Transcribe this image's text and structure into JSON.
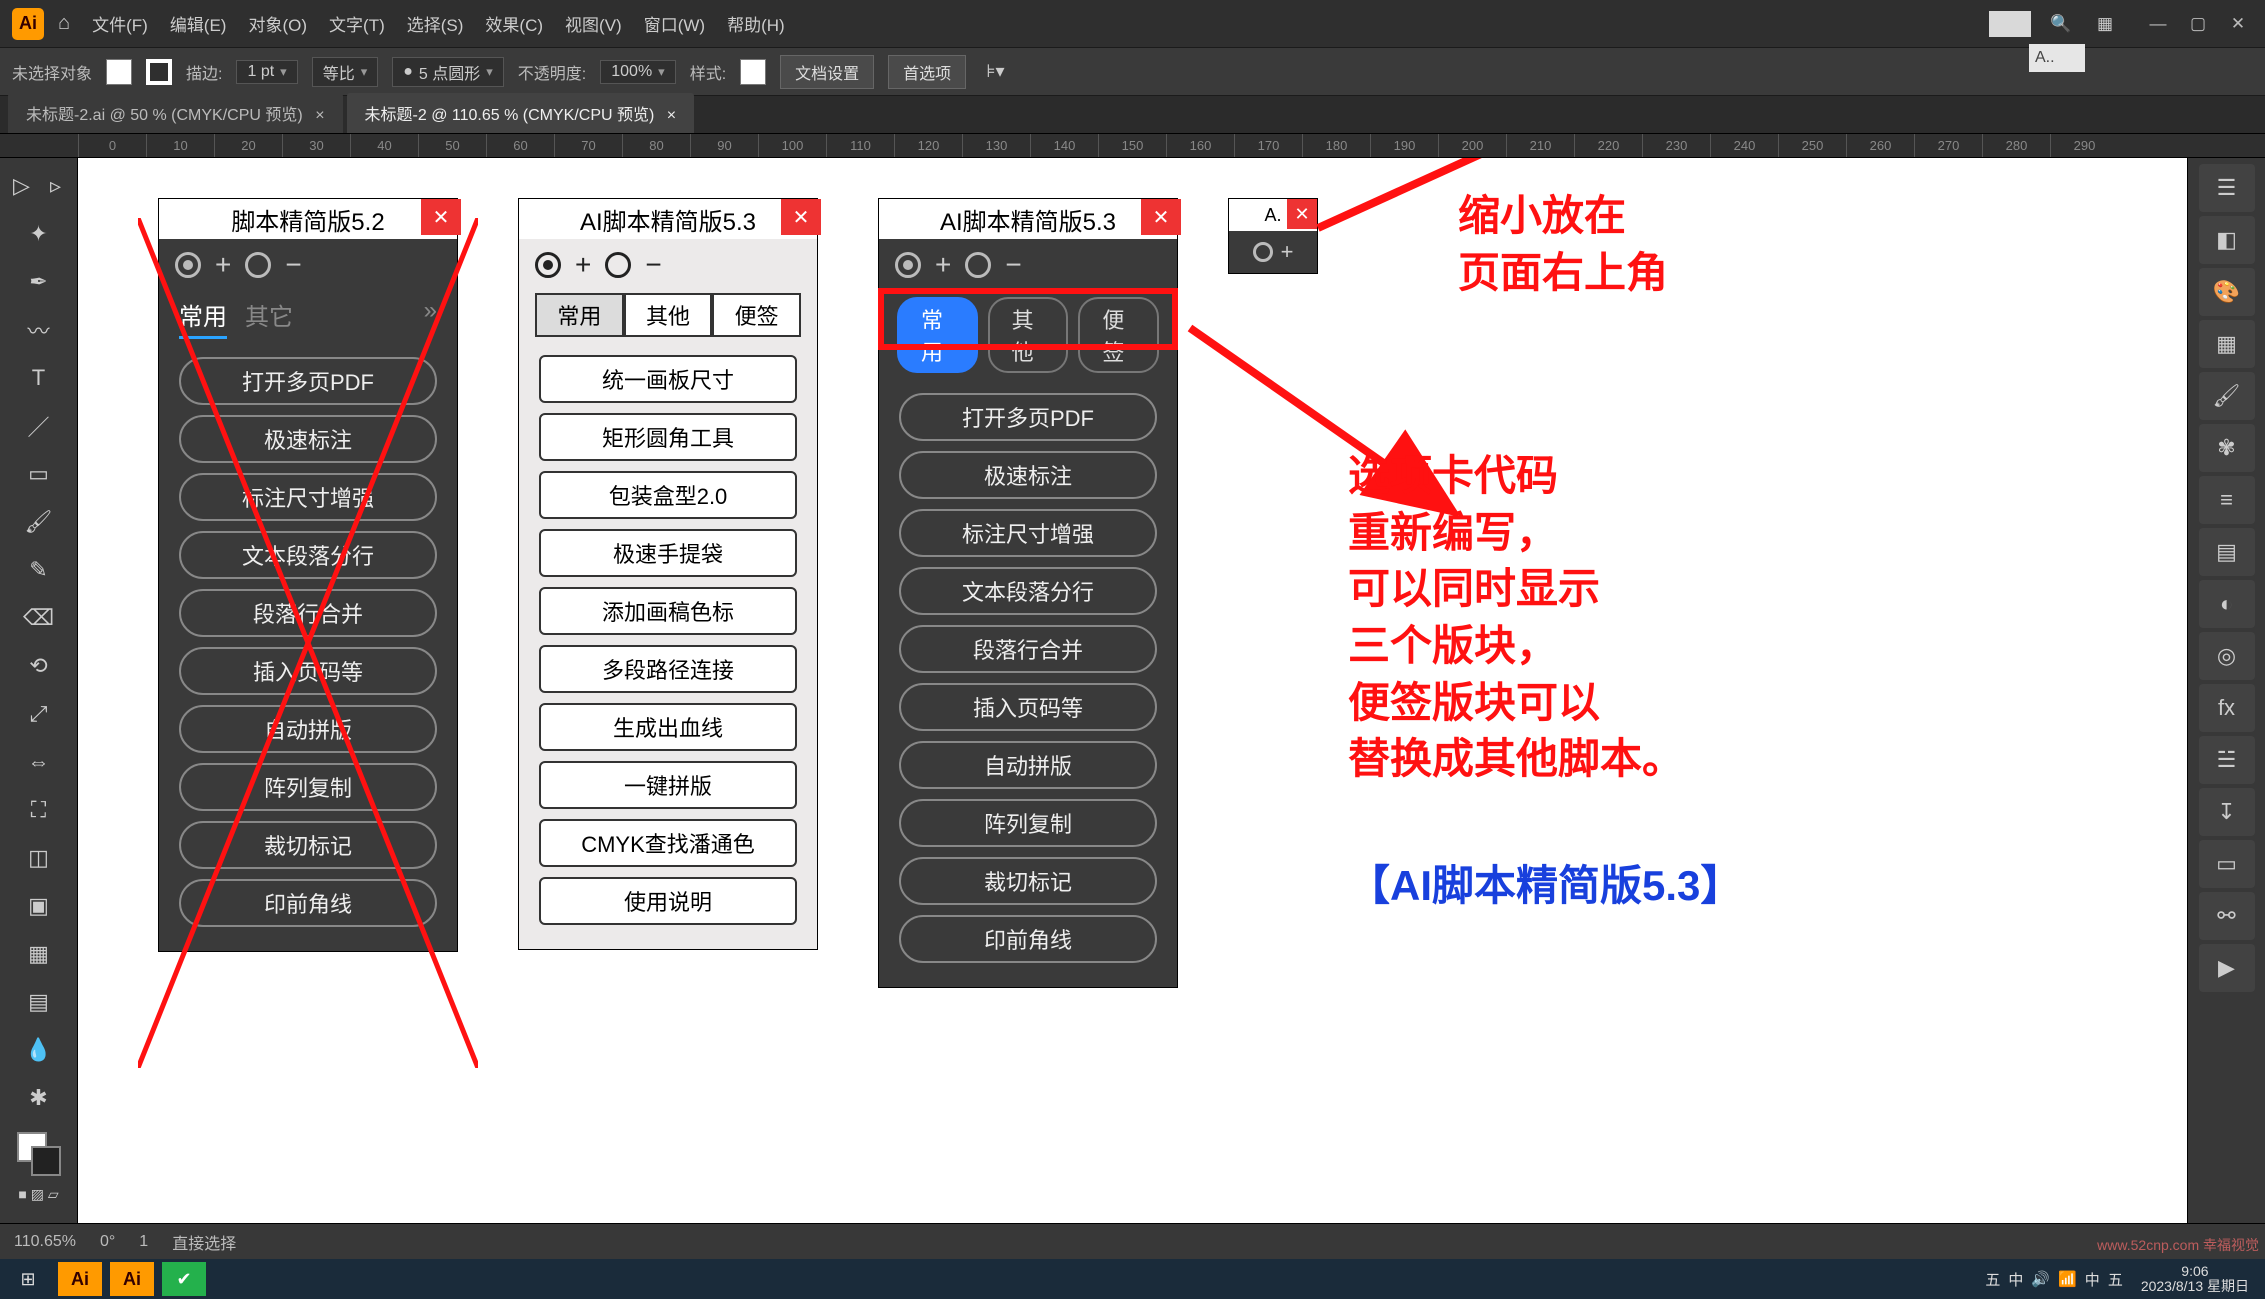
{
  "menubar": {
    "home_icon": "⌂",
    "items": [
      "文件(F)",
      "编辑(E)",
      "对象(O)",
      "文字(T)",
      "选择(S)",
      "效果(C)",
      "视图(V)",
      "窗口(W)",
      "帮助(H)"
    ],
    "search_placeholder": "A..",
    "win": {
      "min": "—",
      "max": "▢",
      "close": "✕"
    }
  },
  "controlbar": {
    "no_selection": "未选择对象",
    "stroke_label": "描边:",
    "stroke_value": "1 pt",
    "uniform": "等比",
    "corner_value": "5 点圆形",
    "opacity_label": "不透明度:",
    "opacity_value": "100%",
    "style_label": "样式:",
    "doc_settings": "文档设置",
    "prefs": "首选项"
  },
  "tabs": [
    {
      "label": "未标题-2.ai @ 50 % (CMYK/CPU 预览)",
      "active": false
    },
    {
      "label": "未标题-2 @ 110.65 % (CMYK/CPU 预览)",
      "active": true
    }
  ],
  "ruler_ticks": [
    "0",
    "10",
    "20",
    "30",
    "40",
    "50",
    "60",
    "70",
    "80",
    "90",
    "100",
    "110",
    "120",
    "130",
    "140",
    "150",
    "160",
    "170",
    "180",
    "190",
    "200",
    "210",
    "220",
    "230",
    "240",
    "250",
    "260",
    "270",
    "280",
    "290"
  ],
  "panels": {
    "p1": {
      "title": "脚本精简版5.2",
      "tabs": [
        "常用",
        "其它"
      ],
      "buttons": [
        "打开多页PDF",
        "极速标注",
        "标注尺寸增强",
        "文本段落分行",
        "段落行合并",
        "插入页码等",
        "自动拼版",
        "阵列复制",
        "裁切标记",
        "印前角线"
      ]
    },
    "p2": {
      "title": "AI脚本精简版5.3",
      "tabs": [
        "常用",
        "其他",
        "便签"
      ],
      "buttons": [
        "统一画板尺寸",
        "矩形圆角工具",
        "包装盒型2.0",
        "极速手提袋",
        "添加画稿色标",
        "多段路径连接",
        "生成出血线",
        "一键拼版",
        "CMYK查找潘通色",
        "使用说明"
      ]
    },
    "p3": {
      "title": "AI脚本精简版5.3",
      "pills": [
        "常用",
        "其他",
        "便签"
      ],
      "buttons": [
        "打开多页PDF",
        "极速标注",
        "标注尺寸增强",
        "文本段落分行",
        "段落行合并",
        "插入页码等",
        "自动拼版",
        "阵列复制",
        "裁切标记",
        "印前角线"
      ]
    },
    "mini": {
      "title": "A."
    }
  },
  "annotations": {
    "top": "缩小放在\n页面右上角",
    "mid": "选项卡代码\n重新编写，\n可以同时显示\n三个版块，\n便签版块可以\n替换成其他脚本。",
    "bottom": "【AI脚本精简版5.3】"
  },
  "statusbar": {
    "zoom": "110.65%",
    "angle": "0°",
    "artboard": "1",
    "select_tool": "直接选择"
  },
  "taskbar": {
    "time": "9:06",
    "date": "2023/8/13 星期日"
  },
  "icons": {
    "home": "⌂",
    "search": "🔍",
    "grid": "▦",
    "plus": "+",
    "minus": "−",
    "chevrons": "»"
  },
  "watermark": "www.52cnp.com 幸福视觉"
}
